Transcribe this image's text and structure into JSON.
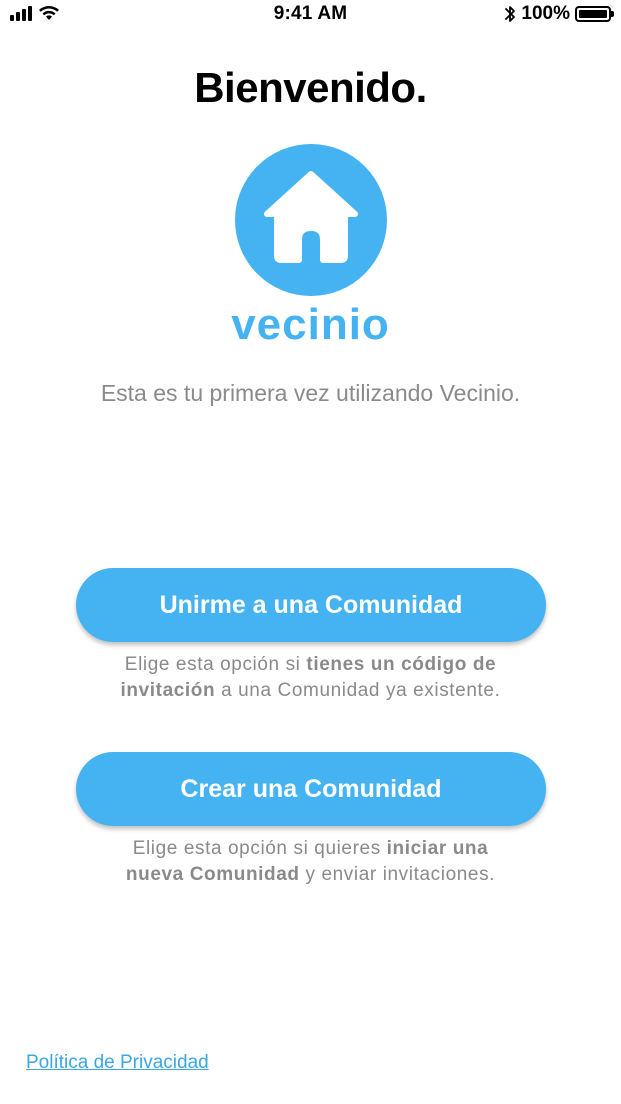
{
  "status_bar": {
    "time": "9:41 AM",
    "battery": "100%",
    "battery_level": 1.0
  },
  "welcome": {
    "title": "Bienvenido.",
    "brand_name": "vecinio",
    "logo_icon": "house-icon",
    "intro": "Esta es tu primera vez utilizando Vecinio."
  },
  "actions": {
    "join": {
      "label": "Unirme a una Comunidad",
      "hint_pre": "Elige esta opción si ",
      "hint_bold_1": "tienes un código de",
      "hint_bold_2": "invitación",
      "hint_post": " a una Comunidad ya existente."
    },
    "create": {
      "label": "Crear una Comunidad",
      "hint_pre": "Elige esta opción si quieres ",
      "hint_bold_1": "iniciar una",
      "hint_bold_2": "nueva Comunidad",
      "hint_post": " y enviar invitaciones."
    }
  },
  "footer": {
    "privacy_link": "Política de Privacidad"
  },
  "colors": {
    "accent": "#45b3f1",
    "muted_text": "#8a8a8a",
    "link": "#3aa6e6"
  }
}
